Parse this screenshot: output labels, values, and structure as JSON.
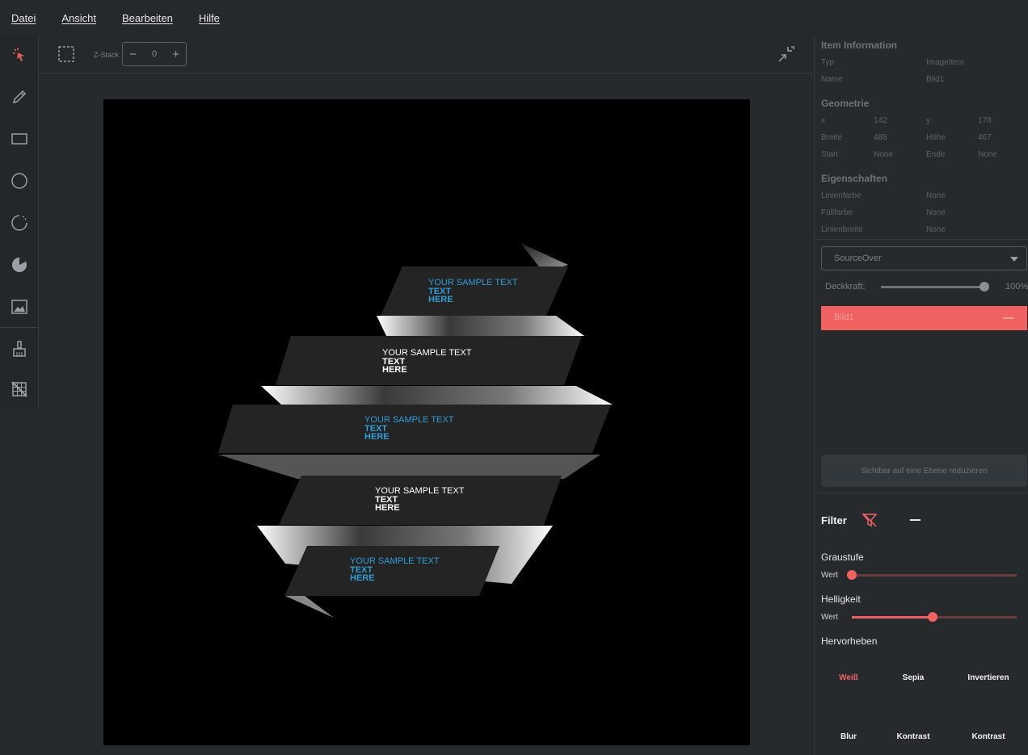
{
  "menu": {
    "items": [
      "Datei",
      "Ansicht",
      "Bearbeiten",
      "Hilfe"
    ]
  },
  "tools": [
    {
      "name": "select-tool",
      "icon": "cursor-sparkle-icon"
    },
    {
      "name": "pen-tool",
      "icon": "pencil-icon"
    },
    {
      "name": "rectangle-tool",
      "icon": "rectangle-icon"
    },
    {
      "name": "ellipse-tool",
      "icon": "circle-icon"
    },
    {
      "name": "arc-tool",
      "icon": "arc-icon"
    },
    {
      "name": "pie-tool",
      "icon": "pie-icon"
    },
    {
      "name": "image-tool",
      "icon": "image-icon"
    },
    {
      "name": "brush-tool",
      "icon": "brush-icon"
    },
    {
      "name": "grid-off-tool",
      "icon": "grid-off-icon"
    }
  ],
  "canvas_toolbar": {
    "zstack_label": "Z-Stack",
    "zstack_value": "0",
    "minus": "−",
    "plus": "+"
  },
  "canvas_image": {
    "ribbons": [
      {
        "heading": "YOUR SAMPLE TEXT",
        "sub1": "TEXT",
        "sub2": "HERE",
        "color": "#2e9ed8"
      },
      {
        "heading": "YOUR SAMPLE TEXT",
        "sub1": "TEXT",
        "sub2": "HERE",
        "color": "#ffffff"
      },
      {
        "heading": "YOUR SAMPLE TEXT",
        "sub1": "TEXT",
        "sub2": "HERE",
        "color": "#2e9ed8"
      },
      {
        "heading": "YOUR SAMPLE TEXT",
        "sub1": "TEXT",
        "sub2": "HERE",
        "color": "#ffffff"
      },
      {
        "heading": "YOUR SAMPLE TEXT",
        "sub1": "TEXT",
        "sub2": "HERE",
        "color": "#2e9ed8"
      }
    ]
  },
  "panel": {
    "item_info": {
      "title": "Item Information",
      "typ_label": "Typ",
      "typ_value": "ImageItem",
      "name_label": "Name",
      "name_value": "Bild1"
    },
    "geometry": {
      "title": "Geometrie",
      "x_label": "x",
      "x_value": "142",
      "y_label": "y",
      "y_value": "178",
      "breite_label": "Breite",
      "breite_value": "488",
      "hoehe_label": "Höhe",
      "hoehe_value": "467",
      "start_label": "Start",
      "start_value": "None",
      "ende_label": "Ende",
      "ende_value": "None"
    },
    "properties": {
      "title": "Eigenschaften",
      "linienfarbe_label": "Linienfarbe",
      "linienfarbe_value": "None",
      "fuellfarbe_label": "Füllfarbe",
      "fuellfarbe_value": "None",
      "linienbreite_label": "Linienbreite",
      "linienbreite_value": "None"
    },
    "blend_mode": "SourceOver",
    "opacity": {
      "label": "Deckkraft:",
      "value": "100%",
      "fraction": 1.0
    },
    "layer": {
      "name": "Bild1",
      "accent": "#f06262"
    },
    "flatten_button": "Sichtbar auf eine Ebene reduzieren",
    "filter": {
      "title": "Filter",
      "graustufe": {
        "title": "Graustufe",
        "wert_label": "Wert",
        "fraction": 0.0
      },
      "helligkeit": {
        "title": "Helligkeit",
        "wert_label": "Wert",
        "fraction": 0.49
      },
      "hervorheben": {
        "title": "Hervorheben"
      },
      "buttons_row1": [
        "Weiß",
        "Sepia",
        "Invertieren"
      ],
      "buttons_row2": [
        "Blur",
        "Kontrast",
        "Kontrast"
      ]
    }
  }
}
